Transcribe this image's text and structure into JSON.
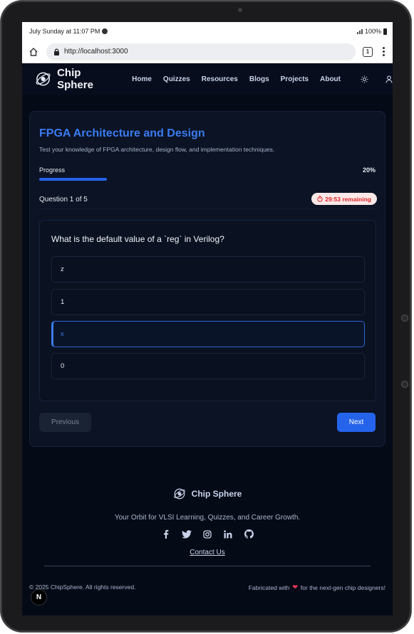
{
  "status_bar": {
    "time_text": "July Sunday at 11:07 PM",
    "battery_text": "100%"
  },
  "address_bar": {
    "url": "http://localhost:3000",
    "tab_count": "1"
  },
  "nav": {
    "brand": "Chip Sphere",
    "links": [
      "Home",
      "Quizzes",
      "Resources",
      "Blogs",
      "Projects",
      "About"
    ]
  },
  "quiz": {
    "title": "FPGA Architecture and Design",
    "description": "Test your knowledge of FPGA architecture, design flow, and implementation techniques.",
    "progress_label": "Progress",
    "progress_text": "20%",
    "progress_value": 0.2,
    "question_counter": "Question 1 of 5",
    "timer_text": "29:53 remaining",
    "question": "What is the default value of a `reg` in Verilog?",
    "options": [
      "z",
      "1",
      "x",
      "0"
    ],
    "selected_option": "x",
    "prev_label": "Previous",
    "next_label": "Next"
  },
  "footer": {
    "brand": "Chip Sphere",
    "tagline": "Your Orbit for VLSI Learning, Quizzes, and Career Growth.",
    "social_icons": [
      "facebook-icon",
      "twitter-icon",
      "instagram-icon",
      "linkedin-icon",
      "github-icon"
    ],
    "contact_label": "Contact Us",
    "copyright": "© 2025 ChipSphere. All rights reserved.",
    "fabricated_prefix": "Fabricated with",
    "fabricated_suffix": "for the next-gen chip designers!"
  },
  "dev_badge": "N",
  "colors": {
    "accent": "#2563eb",
    "background": "#050a17",
    "card": "#0b1324",
    "timer_text": "#dc2626",
    "timer_bg": "#fde8e8"
  }
}
